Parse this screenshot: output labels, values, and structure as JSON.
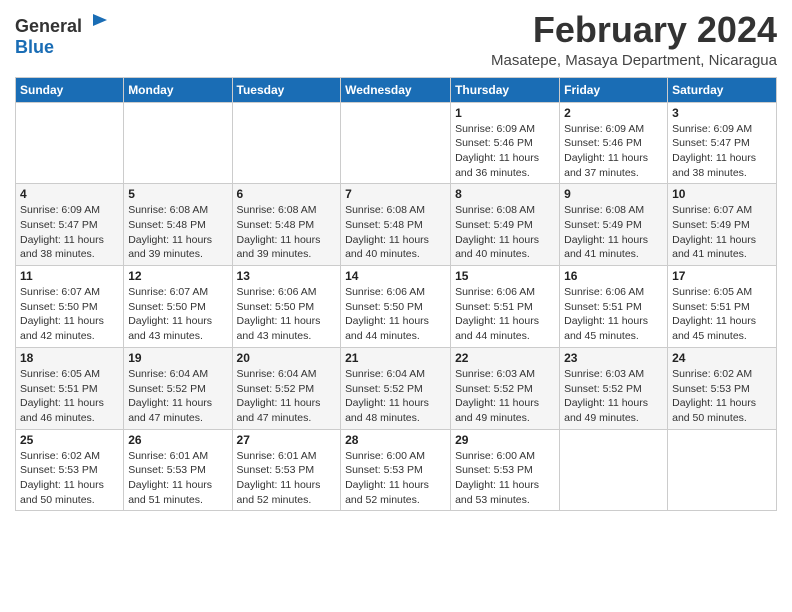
{
  "logo": {
    "text_general": "General",
    "text_blue": "Blue"
  },
  "title": {
    "month_year": "February 2024",
    "location": "Masatepe, Masaya Department, Nicaragua"
  },
  "headers": [
    "Sunday",
    "Monday",
    "Tuesday",
    "Wednesday",
    "Thursday",
    "Friday",
    "Saturday"
  ],
  "weeks": [
    [
      {
        "day": "",
        "info": ""
      },
      {
        "day": "",
        "info": ""
      },
      {
        "day": "",
        "info": ""
      },
      {
        "day": "",
        "info": ""
      },
      {
        "day": "1",
        "info": "Sunrise: 6:09 AM\nSunset: 5:46 PM\nDaylight: 11 hours\nand 36 minutes."
      },
      {
        "day": "2",
        "info": "Sunrise: 6:09 AM\nSunset: 5:46 PM\nDaylight: 11 hours\nand 37 minutes."
      },
      {
        "day": "3",
        "info": "Sunrise: 6:09 AM\nSunset: 5:47 PM\nDaylight: 11 hours\nand 38 minutes."
      }
    ],
    [
      {
        "day": "4",
        "info": "Sunrise: 6:09 AM\nSunset: 5:47 PM\nDaylight: 11 hours\nand 38 minutes."
      },
      {
        "day": "5",
        "info": "Sunrise: 6:08 AM\nSunset: 5:48 PM\nDaylight: 11 hours\nand 39 minutes."
      },
      {
        "day": "6",
        "info": "Sunrise: 6:08 AM\nSunset: 5:48 PM\nDaylight: 11 hours\nand 39 minutes."
      },
      {
        "day": "7",
        "info": "Sunrise: 6:08 AM\nSunset: 5:48 PM\nDaylight: 11 hours\nand 40 minutes."
      },
      {
        "day": "8",
        "info": "Sunrise: 6:08 AM\nSunset: 5:49 PM\nDaylight: 11 hours\nand 40 minutes."
      },
      {
        "day": "9",
        "info": "Sunrise: 6:08 AM\nSunset: 5:49 PM\nDaylight: 11 hours\nand 41 minutes."
      },
      {
        "day": "10",
        "info": "Sunrise: 6:07 AM\nSunset: 5:49 PM\nDaylight: 11 hours\nand 41 minutes."
      }
    ],
    [
      {
        "day": "11",
        "info": "Sunrise: 6:07 AM\nSunset: 5:50 PM\nDaylight: 11 hours\nand 42 minutes."
      },
      {
        "day": "12",
        "info": "Sunrise: 6:07 AM\nSunset: 5:50 PM\nDaylight: 11 hours\nand 43 minutes."
      },
      {
        "day": "13",
        "info": "Sunrise: 6:06 AM\nSunset: 5:50 PM\nDaylight: 11 hours\nand 43 minutes."
      },
      {
        "day": "14",
        "info": "Sunrise: 6:06 AM\nSunset: 5:50 PM\nDaylight: 11 hours\nand 44 minutes."
      },
      {
        "day": "15",
        "info": "Sunrise: 6:06 AM\nSunset: 5:51 PM\nDaylight: 11 hours\nand 44 minutes."
      },
      {
        "day": "16",
        "info": "Sunrise: 6:06 AM\nSunset: 5:51 PM\nDaylight: 11 hours\nand 45 minutes."
      },
      {
        "day": "17",
        "info": "Sunrise: 6:05 AM\nSunset: 5:51 PM\nDaylight: 11 hours\nand 45 minutes."
      }
    ],
    [
      {
        "day": "18",
        "info": "Sunrise: 6:05 AM\nSunset: 5:51 PM\nDaylight: 11 hours\nand 46 minutes."
      },
      {
        "day": "19",
        "info": "Sunrise: 6:04 AM\nSunset: 5:52 PM\nDaylight: 11 hours\nand 47 minutes."
      },
      {
        "day": "20",
        "info": "Sunrise: 6:04 AM\nSunset: 5:52 PM\nDaylight: 11 hours\nand 47 minutes."
      },
      {
        "day": "21",
        "info": "Sunrise: 6:04 AM\nSunset: 5:52 PM\nDaylight: 11 hours\nand 48 minutes."
      },
      {
        "day": "22",
        "info": "Sunrise: 6:03 AM\nSunset: 5:52 PM\nDaylight: 11 hours\nand 49 minutes."
      },
      {
        "day": "23",
        "info": "Sunrise: 6:03 AM\nSunset: 5:52 PM\nDaylight: 11 hours\nand 49 minutes."
      },
      {
        "day": "24",
        "info": "Sunrise: 6:02 AM\nSunset: 5:53 PM\nDaylight: 11 hours\nand 50 minutes."
      }
    ],
    [
      {
        "day": "25",
        "info": "Sunrise: 6:02 AM\nSunset: 5:53 PM\nDaylight: 11 hours\nand 50 minutes."
      },
      {
        "day": "26",
        "info": "Sunrise: 6:01 AM\nSunset: 5:53 PM\nDaylight: 11 hours\nand 51 minutes."
      },
      {
        "day": "27",
        "info": "Sunrise: 6:01 AM\nSunset: 5:53 PM\nDaylight: 11 hours\nand 52 minutes."
      },
      {
        "day": "28",
        "info": "Sunrise: 6:00 AM\nSunset: 5:53 PM\nDaylight: 11 hours\nand 52 minutes."
      },
      {
        "day": "29",
        "info": "Sunrise: 6:00 AM\nSunset: 5:53 PM\nDaylight: 11 hours\nand 53 minutes."
      },
      {
        "day": "",
        "info": ""
      },
      {
        "day": "",
        "info": ""
      }
    ]
  ]
}
